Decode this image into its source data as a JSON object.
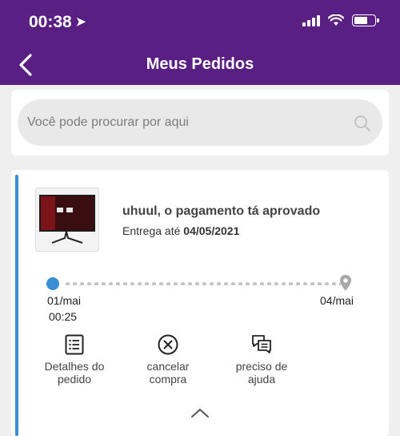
{
  "status_bar": {
    "time": "00:38",
    "location_icon": "location-arrow-icon",
    "icons": [
      "signal-icon",
      "wifi-icon",
      "battery-icon"
    ]
  },
  "header": {
    "title": "Meus Pedidos",
    "back_icon": "back-arrow-icon"
  },
  "search": {
    "placeholder": "Você pode procurar por aqui",
    "icon": "search-icon"
  },
  "order": {
    "status": "uhuul, o pagamento tá aprovado",
    "delivery_prefix": "Entrega até",
    "delivery_date": "04/05/2021",
    "tracker": {
      "start_date": "01/mai",
      "start_time": "00:25",
      "end_date": "04/mai"
    },
    "actions": [
      {
        "label_line1": "Detalhes do",
        "label_line2": "pedido",
        "icon": "list-icon"
      },
      {
        "label_line1": "cancelar",
        "label_line2": "compra",
        "icon": "close-circle-icon"
      },
      {
        "label_line1": "preciso de",
        "label_line2": "ajuda",
        "icon": "chat-icon"
      }
    ]
  },
  "colors": {
    "header": "#5a1f82",
    "accent": "#3a8fd4"
  }
}
